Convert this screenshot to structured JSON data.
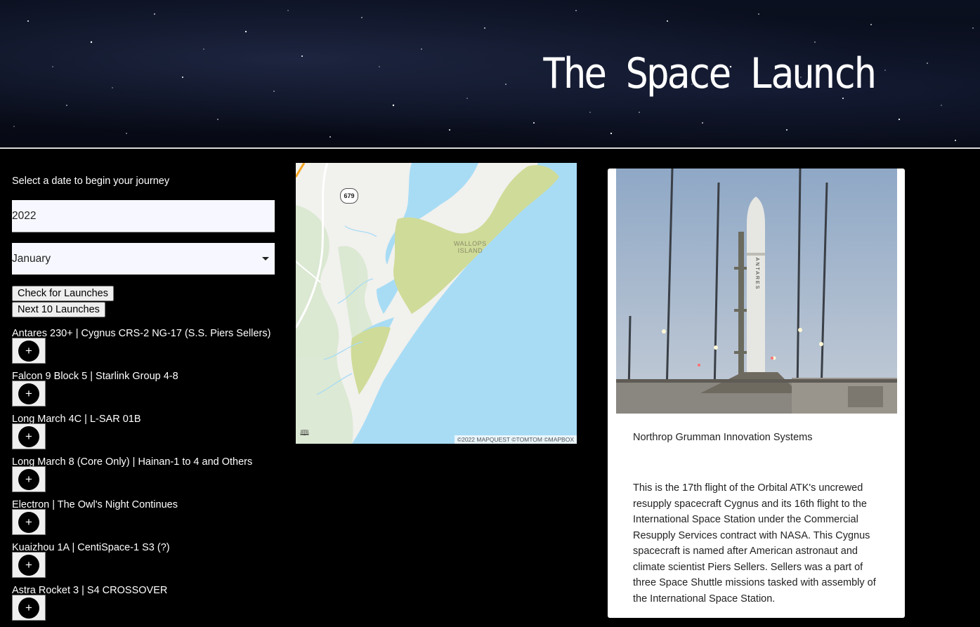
{
  "header": {
    "title": "The Space Launch"
  },
  "form": {
    "prompt": "Select a date to begin your journey",
    "year_value": "2022",
    "month_value": "January",
    "check_button": "Check for Launches",
    "next_button": "Next 10 Launches"
  },
  "launches": [
    {
      "title": "Antares 230+ | Cygnus CRS-2 NG-17 (S.S. Piers Sellers)",
      "add": "+"
    },
    {
      "title": "Falcon 9 Block 5 | Starlink Group 4-8",
      "add": "+"
    },
    {
      "title": "Long March 4C | L-SAR 01B",
      "add": "+"
    },
    {
      "title": "Long March 8 (Core Only) | Hainan-1 to 4 and Others",
      "add": "+"
    },
    {
      "title": "Electron | The Owl's Night Continues",
      "add": "+"
    },
    {
      "title": "Kuaizhou 1A | CentiSpace-1 S3 (?)",
      "add": "+"
    },
    {
      "title": "Astra Rocket 3 | S4 CROSSOVER",
      "add": "+"
    }
  ],
  "map": {
    "place_label_line1": "WALLOPS",
    "place_label_line2": "ISLAND",
    "route_number": "679",
    "attribution": "©2022 MAPQUEST ©TOMTOM ©MAPBOX",
    "colors": {
      "water": "#a8dcf5",
      "land": "#f1f1ee",
      "park": "#cfdb98"
    }
  },
  "card": {
    "agency": "Northrop Grumman Innovation Systems",
    "description": "This is the 17th flight of the Orbital ATK's uncrewed resupply spacecraft Cygnus and its 16th flight to the International Space Station under the Commercial Resupply Services contract with NASA. This Cygnus spacecraft is named after American astronaut and climate scientist Piers Sellers. Sellers was a part of three Space Shuttle missions tasked with assembly of the International Space Station.",
    "rocket_text": "ANTARES"
  }
}
